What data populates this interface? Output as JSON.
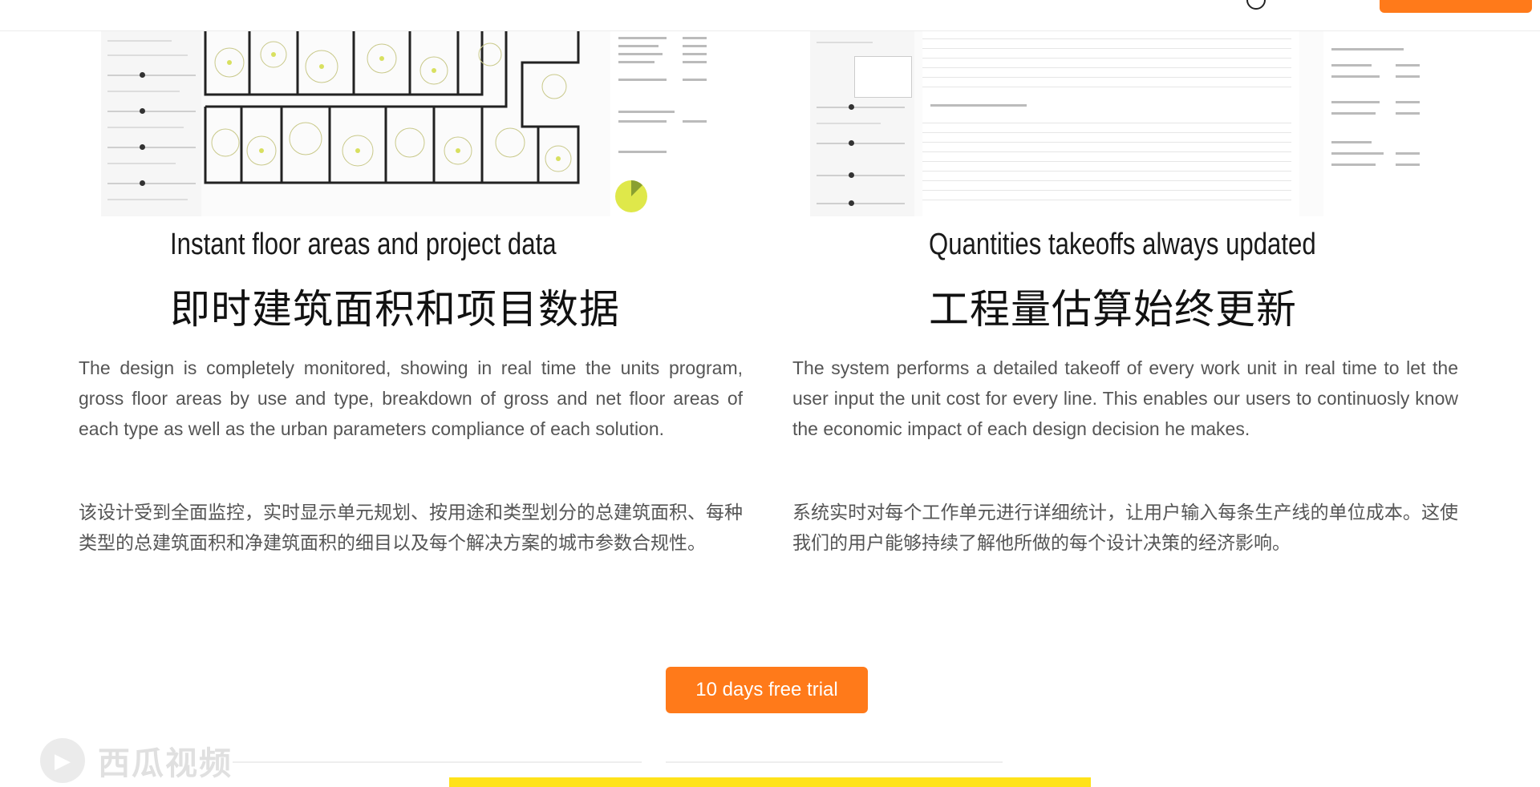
{
  "features": [
    {
      "title_en": "Instant floor areas and project data",
      "title_cn": "即时建筑面积和项目数据",
      "desc_en": "The design is completely monitored, showing in real time the units program, gross floor areas by use and type, breakdown of gross and net floor areas of each type as well as the urban parameters compliance of each solution.",
      "desc_cn": "该设计受到全面监控，实时显示单元规划、按用途和类型划分的总建筑面积、每种类型的总建筑面积和净建筑面积的细目以及每个解决方案的城市参数合规性。"
    },
    {
      "title_en": "Quantities takeoffs always updated",
      "title_cn": "工程量估算始终更新",
      "desc_en": "The system performs a detailed takeoff of every work unit in real time to let the user input the unit cost for every line. This enables our users to continuosly know the economic impact of each design decision he makes.",
      "desc_cn": "系统实时对每个工作单元进行详细统计，让用户输入每条生产线的单位成本。这使我们的用户能够持续了解他所做的每个设计决策的经济影响。"
    }
  ],
  "cta": {
    "label": "10 days free trial"
  },
  "watermark": {
    "text": "西瓜视频"
  },
  "colors": {
    "accent": "#ff7a1a",
    "yellow_strip": "#ffe21a"
  },
  "icons": {
    "language": "globe-icon",
    "watermark": "play-icon"
  }
}
